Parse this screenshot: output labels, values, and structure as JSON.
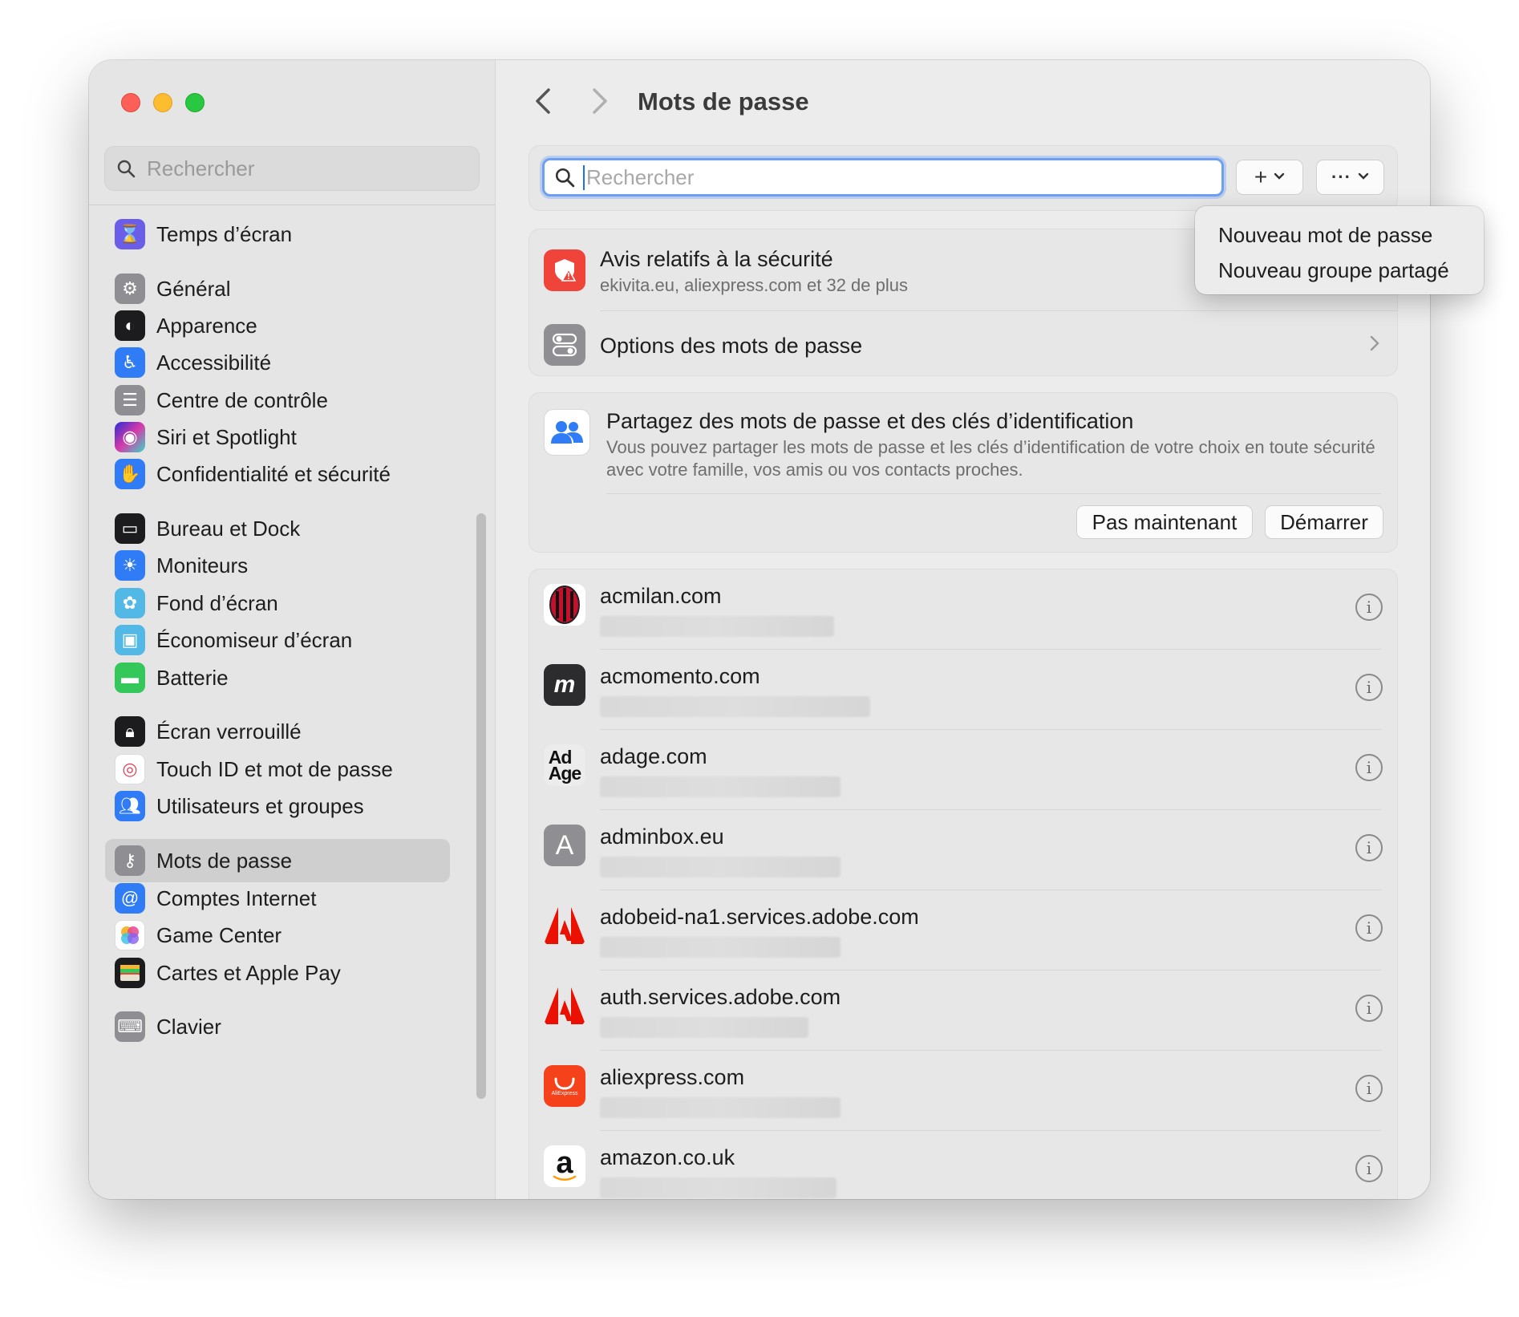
{
  "sidebar": {
    "search_placeholder": "Rechercher",
    "items": [
      {
        "label": "Temps d’écran",
        "icon": "hourglass-icon",
        "color": "#6a5ee8"
      },
      {
        "label": "Général",
        "icon": "gear-icon",
        "color": "#8e8e93"
      },
      {
        "label": "Apparence",
        "icon": "appearance-icon",
        "color": "#1c1c1e"
      },
      {
        "label": "Accessibilité",
        "icon": "accessibility-icon",
        "color": "#2f7cf6"
      },
      {
        "label": "Centre de contrôle",
        "icon": "toggles-icon",
        "color": "#8e8e93"
      },
      {
        "label": "Siri et Spotlight",
        "icon": "siri-icon",
        "color": "#9b3ad6"
      },
      {
        "label": "Confidentialité et sécurité",
        "icon": "hand-icon",
        "color": "#2f7cf6"
      },
      {
        "label": "Bureau et Dock",
        "icon": "dock-icon",
        "color": "#1c1c1e"
      },
      {
        "label": "Moniteurs",
        "icon": "sun-icon",
        "color": "#2f7cf6"
      },
      {
        "label": "Fond d’écran",
        "icon": "flower-icon",
        "color": "#52b9e6"
      },
      {
        "label": "Économiseur d’écran",
        "icon": "screensaver-icon",
        "color": "#52b9e6"
      },
      {
        "label": "Batterie",
        "icon": "battery-icon",
        "color": "#34c759"
      },
      {
        "label": "Écran verrouillé",
        "icon": "lock-icon",
        "color": "#1c1c1e"
      },
      {
        "label": "Touch ID et mot de passe",
        "icon": "fingerprint-icon",
        "color": "#ffffff"
      },
      {
        "label": "Utilisateurs et groupes",
        "icon": "users-icon",
        "color": "#2f7cf6"
      },
      {
        "label": "Mots de passe",
        "icon": "key-icon",
        "color": "#8e8e93"
      },
      {
        "label": "Comptes Internet",
        "icon": "at-icon",
        "color": "#2f7cf6"
      },
      {
        "label": "Game Center",
        "icon": "game-center-icon",
        "color": "#ffffff"
      },
      {
        "label": "Cartes et Apple Pay",
        "icon": "wallet-icon",
        "color": "#1c1c1e"
      },
      {
        "label": "Clavier",
        "icon": "keyboard-icon",
        "color": "#8e8e93"
      }
    ]
  },
  "main": {
    "title": "Mots de passe",
    "search_placeholder": "Rechercher",
    "add_symbol": "+",
    "more_symbol": "···",
    "security": {
      "title": "Avis relatifs à la sécurité",
      "subtitle": "ekivita.eu, aliexpress.com et 32 de plus"
    },
    "options_label": "Options des mots de passe",
    "share": {
      "title": "Partagez des mots de passe et des clés d’identification",
      "description": "Vous pouvez partager les mots de passe et les clés d’identification de votre choix en toute sécurité avec votre famille, vos amis ou vos contacts proches.",
      "later_label": "Pas maintenant",
      "start_label": "Démarrer"
    },
    "passwords": [
      {
        "domain": "acmilan.com",
        "icon_text": "",
        "icon_color": "#ffffff"
      },
      {
        "domain": "acmomento.com",
        "icon_text": "m",
        "icon_color": "#2c2c2e"
      },
      {
        "domain": "adage.com",
        "icon_text": "Ad\nAge",
        "icon_color": "#ececec"
      },
      {
        "domain": "adminbox.eu",
        "icon_text": "A",
        "icon_color": "#8e8e93"
      },
      {
        "domain": "adobeid-na1.services.adobe.com",
        "icon_text": "",
        "icon_color": "#ffffff"
      },
      {
        "domain": "auth.services.adobe.com",
        "icon_text": "",
        "icon_color": "#ffffff"
      },
      {
        "domain": "aliexpress.com",
        "icon_text": "AliExpress",
        "icon_color": "#f5421b"
      },
      {
        "domain": "amazon.co.uk",
        "icon_text": "a",
        "icon_color": "#ffffff"
      }
    ]
  },
  "dropdown": {
    "items": [
      "Nouveau mot de passe",
      "Nouveau groupe partagé"
    ]
  }
}
